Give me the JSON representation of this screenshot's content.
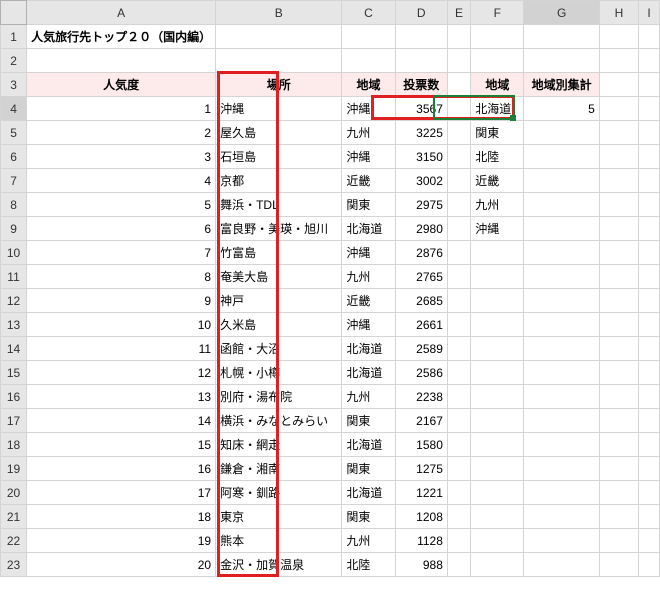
{
  "columns": [
    "A",
    "B",
    "C",
    "D",
    "E",
    "F",
    "G",
    "H",
    "I"
  ],
  "title_cell": "人気旅行先トップ２０（国内編）",
  "headers_main": {
    "A": "人気度",
    "B": "場所",
    "C": "地域",
    "D": "投票数"
  },
  "headers_side": {
    "F": "地域",
    "G": "地域別集計"
  },
  "rows": [
    {
      "rank": 1,
      "place": "沖縄",
      "region": "沖縄",
      "votes": 3567
    },
    {
      "rank": 2,
      "place": "屋久島",
      "region": "九州",
      "votes": 3225
    },
    {
      "rank": 3,
      "place": "石垣島",
      "region": "沖縄",
      "votes": 3150
    },
    {
      "rank": 4,
      "place": "京都",
      "region": "近畿",
      "votes": 3002
    },
    {
      "rank": 5,
      "place": "舞浜・TDL",
      "region": "関東",
      "votes": 2975
    },
    {
      "rank": 6,
      "place": "富良野・美瑛・旭川",
      "region": "北海道",
      "votes": 2980
    },
    {
      "rank": 7,
      "place": "竹富島",
      "region": "沖縄",
      "votes": 2876
    },
    {
      "rank": 8,
      "place": "奄美大島",
      "region": "九州",
      "votes": 2765
    },
    {
      "rank": 9,
      "place": "神戸",
      "region": "近畿",
      "votes": 2685
    },
    {
      "rank": 10,
      "place": "久米島",
      "region": "沖縄",
      "votes": 2661
    },
    {
      "rank": 11,
      "place": "函館・大沼",
      "region": "北海道",
      "votes": 2589
    },
    {
      "rank": 12,
      "place": "札幌・小樽",
      "region": "北海道",
      "votes": 2586
    },
    {
      "rank": 13,
      "place": "別府・湯布院",
      "region": "九州",
      "votes": 2238
    },
    {
      "rank": 14,
      "place": "横浜・みなとみらい",
      "region": "関東",
      "votes": 2167
    },
    {
      "rank": 15,
      "place": "知床・網走",
      "region": "北海道",
      "votes": 1580
    },
    {
      "rank": 16,
      "place": "鎌倉・湘南",
      "region": "関東",
      "votes": 1275
    },
    {
      "rank": 17,
      "place": "阿寒・釧路",
      "region": "北海道",
      "votes": 1221
    },
    {
      "rank": 18,
      "place": "東京",
      "region": "関東",
      "votes": 1208
    },
    {
      "rank": 19,
      "place": "熊本",
      "region": "九州",
      "votes": 1128
    },
    {
      "rank": 20,
      "place": "金沢・加賀温泉",
      "region": "北陸",
      "votes": 988
    }
  ],
  "side_rows": [
    {
      "region": "北海道",
      "count": 5
    },
    {
      "region": "関東",
      "count": ""
    },
    {
      "region": "北陸",
      "count": ""
    },
    {
      "region": "近畿",
      "count": ""
    },
    {
      "region": "九州",
      "count": ""
    },
    {
      "region": "沖縄",
      "count": ""
    }
  ],
  "active_cell": "G4",
  "chart_data": {
    "type": "table",
    "title": "人気旅行先トップ２０（国内編）",
    "columns": [
      "人気度",
      "場所",
      "地域",
      "投票数"
    ],
    "data": [
      [
        1,
        "沖縄",
        "沖縄",
        3567
      ],
      [
        2,
        "屋久島",
        "九州",
        3225
      ],
      [
        3,
        "石垣島",
        "沖縄",
        3150
      ],
      [
        4,
        "京都",
        "近畿",
        3002
      ],
      [
        5,
        "舞浜・TDL",
        "関東",
        2975
      ],
      [
        6,
        "富良野・美瑛・旭川",
        "北海道",
        2980
      ],
      [
        7,
        "竹富島",
        "沖縄",
        2876
      ],
      [
        8,
        "奄美大島",
        "九州",
        2765
      ],
      [
        9,
        "神戸",
        "近畿",
        2685
      ],
      [
        10,
        "久米島",
        "沖縄",
        2661
      ],
      [
        11,
        "函館・大沼",
        "北海道",
        2589
      ],
      [
        12,
        "札幌・小樽",
        "北海道",
        2586
      ],
      [
        13,
        "別府・湯布院",
        "九州",
        2238
      ],
      [
        14,
        "横浜・みなとみらい",
        "関東",
        2167
      ],
      [
        15,
        "知床・網走",
        "北海道",
        1580
      ],
      [
        16,
        "鎌倉・湘南",
        "関東",
        1275
      ],
      [
        17,
        "阿寒・釧路",
        "北海道",
        1221
      ],
      [
        18,
        "東京",
        "関東",
        1208
      ],
      [
        19,
        "熊本",
        "九州",
        1128
      ],
      [
        20,
        "金沢・加賀温泉",
        "北陸",
        988
      ]
    ],
    "side_table": {
      "columns": [
        "地域",
        "地域別集計"
      ],
      "data": [
        [
          "北海道",
          5
        ],
        [
          "関東",
          null
        ],
        [
          "北陸",
          null
        ],
        [
          "近畿",
          null
        ],
        [
          "九州",
          null
        ],
        [
          "沖縄",
          null
        ]
      ]
    }
  }
}
